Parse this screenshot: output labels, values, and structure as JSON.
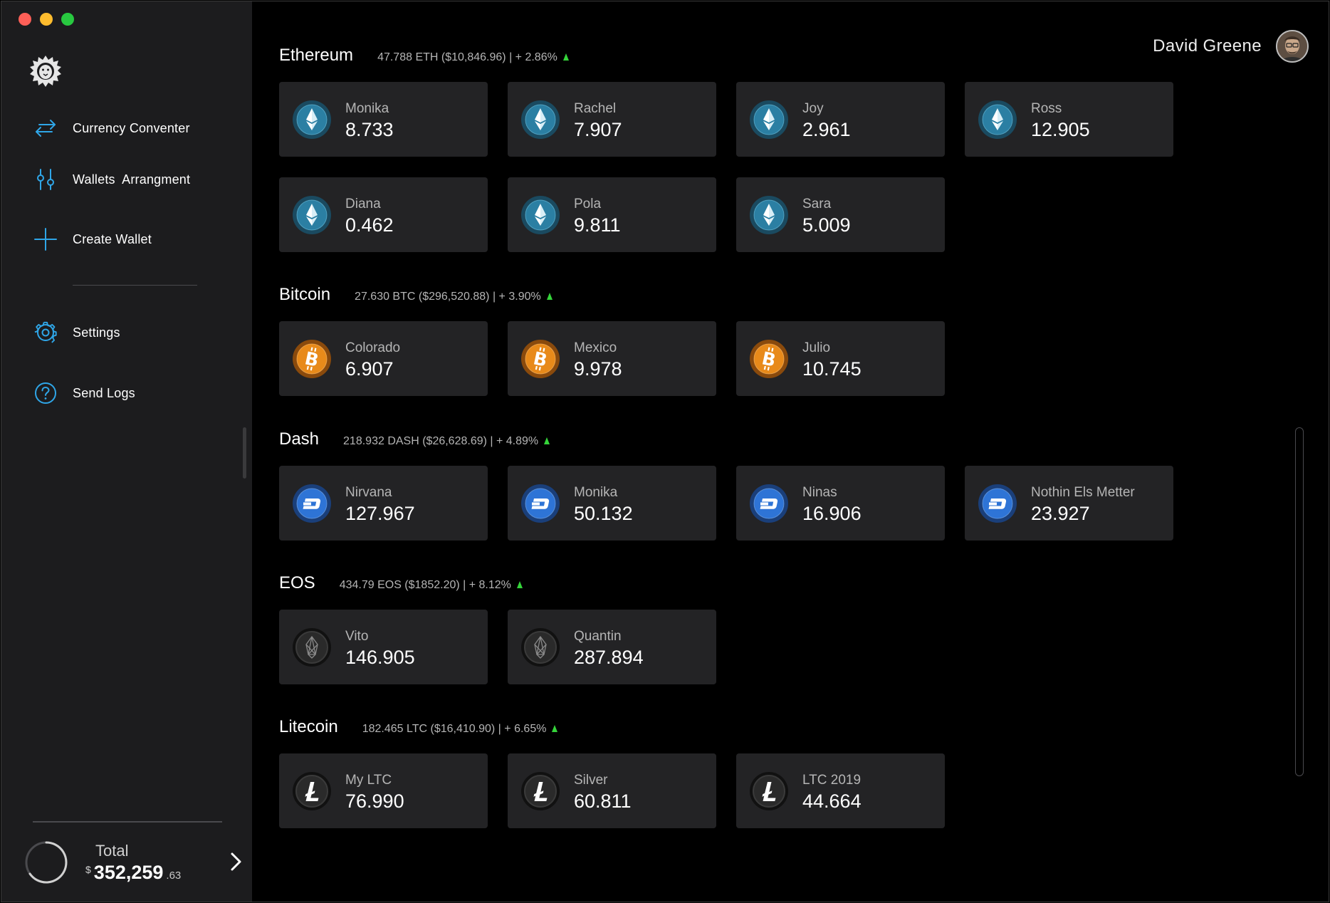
{
  "sidebar": {
    "nav": [
      {
        "label": "Currency Conventer",
        "icon": "exchange-arrows-icon"
      },
      {
        "label": "Wallets  Arrangment",
        "icon": "sliders-icon"
      },
      {
        "label": "Create Wallet",
        "icon": "plus-icon"
      },
      {
        "label": "Settings",
        "icon": "gear-icon"
      },
      {
        "label": "Send Logs",
        "icon": "question-icon"
      }
    ],
    "total": {
      "label": "Total",
      "currency": "$",
      "amount": "352,259",
      "cents": ".63"
    }
  },
  "user": {
    "name": "David Greene"
  },
  "colors": {
    "accent": "#2fa6e8",
    "up": "#35d43a",
    "card": "#232325",
    "sidebar": "#1c1c1e",
    "eth": "#2b7fa3",
    "btc": "#e88a1a",
    "dash": "#2e74d6",
    "eos": "#2a2a2a",
    "ltc": "#2a2a2a"
  },
  "sections": [
    {
      "title": "Ethereum",
      "summary": "47.788 ETH ($10,846.96) | + 2.86%",
      "coin": "ethereum-icon",
      "wallets": [
        {
          "name": "Monika",
          "value": "8.733"
        },
        {
          "name": "Rachel",
          "value": "7.907"
        },
        {
          "name": "Joy",
          "value": "2.961"
        },
        {
          "name": "Ross",
          "value": "12.905"
        },
        {
          "name": "Diana",
          "value": "0.462"
        },
        {
          "name": "Pola",
          "value": "9.811"
        },
        {
          "name": "Sara",
          "value": "5.009"
        }
      ]
    },
    {
      "title": "Bitcoin",
      "summary": "27.630 BTC ($296,520.88) | + 3.90%",
      "coin": "bitcoin-icon",
      "wallets": [
        {
          "name": "Colorado",
          "value": "6.907"
        },
        {
          "name": "Mexico",
          "value": "9.978"
        },
        {
          "name": "Julio",
          "value": "10.745"
        }
      ]
    },
    {
      "title": "Dash",
      "summary": "218.932 DASH ($26,628.69) | + 4.89%",
      "coin": "dash-icon",
      "wallets": [
        {
          "name": "Nirvana",
          "value": "127.967"
        },
        {
          "name": "Monika",
          "value": "50.132"
        },
        {
          "name": "Ninas",
          "value": "16.906"
        },
        {
          "name": "Nothin Els Metter",
          "value": "23.927"
        }
      ]
    },
    {
      "title": "EOS",
      "summary": "434.79 EOS ($1852.20) | + 8.12%",
      "coin": "eos-icon",
      "wallets": [
        {
          "name": "Vito",
          "value": "146.905"
        },
        {
          "name": "Quantin",
          "value": "287.894"
        }
      ]
    },
    {
      "title": "Litecoin",
      "summary": "182.465 LTC ($16,410.90) | + 6.65%",
      "coin": "litecoin-icon",
      "wallets": [
        {
          "name": "My LTC",
          "value": "76.990"
        },
        {
          "name": "Silver",
          "value": "60.811"
        },
        {
          "name": "LTC 2019",
          "value": "44.664"
        }
      ]
    }
  ]
}
